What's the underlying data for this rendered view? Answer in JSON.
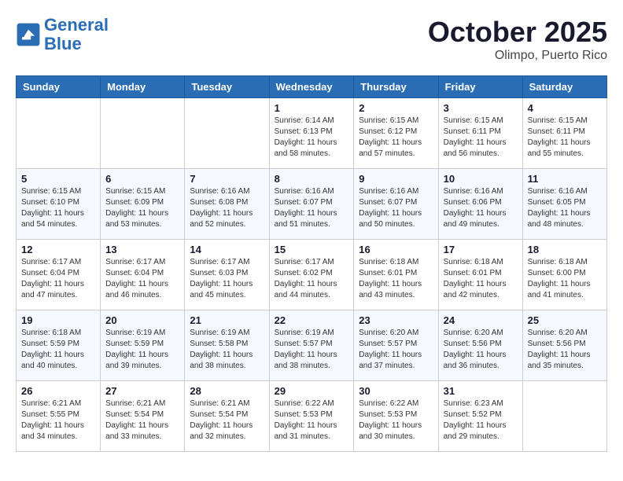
{
  "header": {
    "logo_line1": "General",
    "logo_line2": "Blue",
    "month": "October 2025",
    "location": "Olimpo, Puerto Rico"
  },
  "weekdays": [
    "Sunday",
    "Monday",
    "Tuesday",
    "Wednesday",
    "Thursday",
    "Friday",
    "Saturday"
  ],
  "weeks": [
    [
      {
        "day": "",
        "info": ""
      },
      {
        "day": "",
        "info": ""
      },
      {
        "day": "",
        "info": ""
      },
      {
        "day": "1",
        "info": "Sunrise: 6:14 AM\nSunset: 6:13 PM\nDaylight: 11 hours\nand 58 minutes."
      },
      {
        "day": "2",
        "info": "Sunrise: 6:15 AM\nSunset: 6:12 PM\nDaylight: 11 hours\nand 57 minutes."
      },
      {
        "day": "3",
        "info": "Sunrise: 6:15 AM\nSunset: 6:11 PM\nDaylight: 11 hours\nand 56 minutes."
      },
      {
        "day": "4",
        "info": "Sunrise: 6:15 AM\nSunset: 6:11 PM\nDaylight: 11 hours\nand 55 minutes."
      }
    ],
    [
      {
        "day": "5",
        "info": "Sunrise: 6:15 AM\nSunset: 6:10 PM\nDaylight: 11 hours\nand 54 minutes."
      },
      {
        "day": "6",
        "info": "Sunrise: 6:15 AM\nSunset: 6:09 PM\nDaylight: 11 hours\nand 53 minutes."
      },
      {
        "day": "7",
        "info": "Sunrise: 6:16 AM\nSunset: 6:08 PM\nDaylight: 11 hours\nand 52 minutes."
      },
      {
        "day": "8",
        "info": "Sunrise: 6:16 AM\nSunset: 6:07 PM\nDaylight: 11 hours\nand 51 minutes."
      },
      {
        "day": "9",
        "info": "Sunrise: 6:16 AM\nSunset: 6:07 PM\nDaylight: 11 hours\nand 50 minutes."
      },
      {
        "day": "10",
        "info": "Sunrise: 6:16 AM\nSunset: 6:06 PM\nDaylight: 11 hours\nand 49 minutes."
      },
      {
        "day": "11",
        "info": "Sunrise: 6:16 AM\nSunset: 6:05 PM\nDaylight: 11 hours\nand 48 minutes."
      }
    ],
    [
      {
        "day": "12",
        "info": "Sunrise: 6:17 AM\nSunset: 6:04 PM\nDaylight: 11 hours\nand 47 minutes."
      },
      {
        "day": "13",
        "info": "Sunrise: 6:17 AM\nSunset: 6:04 PM\nDaylight: 11 hours\nand 46 minutes."
      },
      {
        "day": "14",
        "info": "Sunrise: 6:17 AM\nSunset: 6:03 PM\nDaylight: 11 hours\nand 45 minutes."
      },
      {
        "day": "15",
        "info": "Sunrise: 6:17 AM\nSunset: 6:02 PM\nDaylight: 11 hours\nand 44 minutes."
      },
      {
        "day": "16",
        "info": "Sunrise: 6:18 AM\nSunset: 6:01 PM\nDaylight: 11 hours\nand 43 minutes."
      },
      {
        "day": "17",
        "info": "Sunrise: 6:18 AM\nSunset: 6:01 PM\nDaylight: 11 hours\nand 42 minutes."
      },
      {
        "day": "18",
        "info": "Sunrise: 6:18 AM\nSunset: 6:00 PM\nDaylight: 11 hours\nand 41 minutes."
      }
    ],
    [
      {
        "day": "19",
        "info": "Sunrise: 6:18 AM\nSunset: 5:59 PM\nDaylight: 11 hours\nand 40 minutes."
      },
      {
        "day": "20",
        "info": "Sunrise: 6:19 AM\nSunset: 5:59 PM\nDaylight: 11 hours\nand 39 minutes."
      },
      {
        "day": "21",
        "info": "Sunrise: 6:19 AM\nSunset: 5:58 PM\nDaylight: 11 hours\nand 38 minutes."
      },
      {
        "day": "22",
        "info": "Sunrise: 6:19 AM\nSunset: 5:57 PM\nDaylight: 11 hours\nand 38 minutes."
      },
      {
        "day": "23",
        "info": "Sunrise: 6:20 AM\nSunset: 5:57 PM\nDaylight: 11 hours\nand 37 minutes."
      },
      {
        "day": "24",
        "info": "Sunrise: 6:20 AM\nSunset: 5:56 PM\nDaylight: 11 hours\nand 36 minutes."
      },
      {
        "day": "25",
        "info": "Sunrise: 6:20 AM\nSunset: 5:56 PM\nDaylight: 11 hours\nand 35 minutes."
      }
    ],
    [
      {
        "day": "26",
        "info": "Sunrise: 6:21 AM\nSunset: 5:55 PM\nDaylight: 11 hours\nand 34 minutes."
      },
      {
        "day": "27",
        "info": "Sunrise: 6:21 AM\nSunset: 5:54 PM\nDaylight: 11 hours\nand 33 minutes."
      },
      {
        "day": "28",
        "info": "Sunrise: 6:21 AM\nSunset: 5:54 PM\nDaylight: 11 hours\nand 32 minutes."
      },
      {
        "day": "29",
        "info": "Sunrise: 6:22 AM\nSunset: 5:53 PM\nDaylight: 11 hours\nand 31 minutes."
      },
      {
        "day": "30",
        "info": "Sunrise: 6:22 AM\nSunset: 5:53 PM\nDaylight: 11 hours\nand 30 minutes."
      },
      {
        "day": "31",
        "info": "Sunrise: 6:23 AM\nSunset: 5:52 PM\nDaylight: 11 hours\nand 29 minutes."
      },
      {
        "day": "",
        "info": ""
      }
    ]
  ]
}
